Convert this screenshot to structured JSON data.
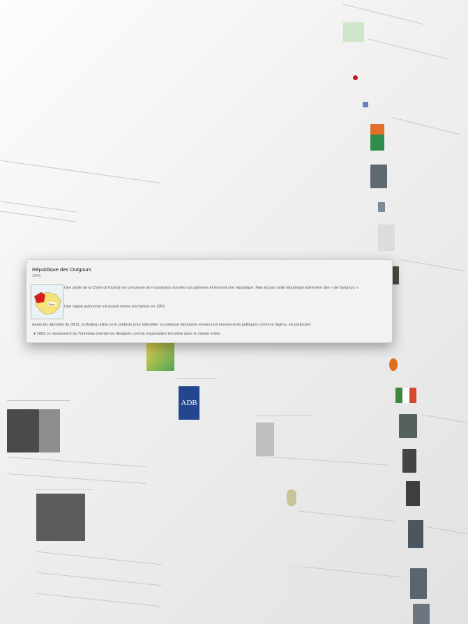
{
  "focused_event": {
    "title": "République des Ouïgours",
    "year": "1949",
    "map_label": "Chine",
    "paragraph_1": "Une partie de la Chine (à l'ouest) est composée de musulmans sunnites turcophones et forment une république. Mao écrase cette république éphémère dite « de Ouïgours ».",
    "paragraph_2": "Une région autonome est quand meme proclamée en 1955.",
    "paragraph_3": "Après les attentats du 09/11, la Beijing utilise ce le prétexte pour intensifier sa politique répressive envers tout mouvements politiques contre le régime, en particulier :",
    "bullet_1": "2002, le mouvement du Turkestan oriental est désignée comme  organisation terroriste dans le monde entier."
  },
  "background": {
    "adb_logo_text": "ADB"
  },
  "colors": {
    "card_bg": "#f2f2f2",
    "adb_blue": "#23468f",
    "map_red": "#d62020",
    "map_yellow": "#f3e37a"
  }
}
